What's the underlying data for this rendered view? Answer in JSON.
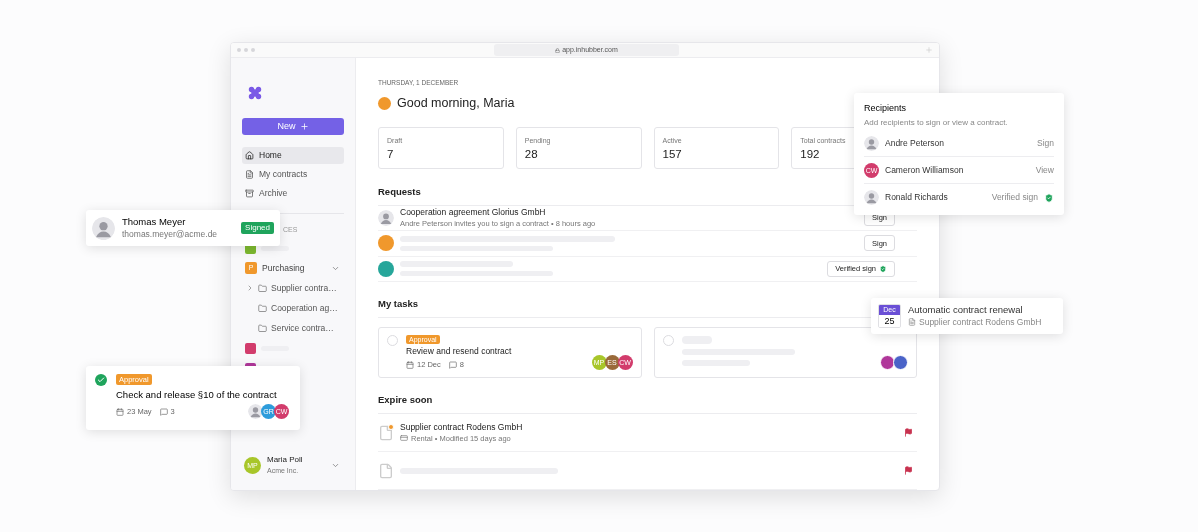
{
  "window": {
    "url": "app.inhubber.com"
  },
  "sidebar": {
    "new_button": "New",
    "nav": [
      {
        "label": "Home",
        "selected": true
      },
      {
        "label": "My contracts",
        "selected": false
      },
      {
        "label": "Archive",
        "selected": false
      }
    ],
    "section_label": "CES",
    "workspaces": [
      {
        "kind": "placeholder",
        "color": "#7cb82f"
      },
      {
        "kind": "workspace",
        "letter": "P",
        "label": "Purchasing",
        "color": "#f0982c",
        "expanded": true,
        "children": [
          {
            "label": "Supplier contra…",
            "has_children": true
          },
          {
            "label": "Cooperation ag…",
            "has_children": false
          },
          {
            "label": "Service contra…",
            "has_children": false
          }
        ]
      },
      {
        "kind": "placeholder",
        "color": "#d23c6c"
      },
      {
        "kind": "placeholder",
        "color": "#b0379a"
      }
    ],
    "user": {
      "initials": "MP",
      "name": "Maria Poll",
      "org": "Acme Inc.",
      "color": "#a8c62a"
    }
  },
  "main": {
    "date": "THURSDAY, 1 DECEMBER",
    "greeting": "Good morning, Maria",
    "stats": [
      {
        "label": "Draft",
        "value": "7"
      },
      {
        "label": "Pending",
        "value": "28"
      },
      {
        "label": "Active",
        "value": "157"
      },
      {
        "label": "Total contracts",
        "value": "192"
      }
    ],
    "requests": {
      "title": "Requests",
      "rows": [
        {
          "kind": "request",
          "title": "Cooperation agreement Glorius GmbH",
          "subtitle": "Andre Peterson invites you to sign a contract • 8 hours ago",
          "action": "Sign",
          "verified": false
        },
        {
          "kind": "placeholder",
          "color": "#f0982c",
          "action": "Sign",
          "verified": false
        },
        {
          "kind": "placeholder",
          "color": "#26a69a",
          "action": "Verified sign",
          "verified": true
        }
      ]
    },
    "tasks": {
      "title": "My tasks",
      "items": [
        {
          "kind": "task",
          "tag": "Approval",
          "title": "Review and resend contract",
          "date": "12 Dec",
          "comments": "8",
          "done": false,
          "assignees": [
            {
              "kind": "initials",
              "initials": "MP",
              "color": "#a8c62a"
            },
            {
              "kind": "initials",
              "initials": "ES",
              "color": "#9a6a3a"
            },
            {
              "kind": "initials",
              "initials": "CW",
              "color": "#d23c6c"
            }
          ]
        },
        {
          "kind": "placeholder",
          "done": false,
          "assignees": [
            {
              "kind": "blank",
              "color": "#b0379a"
            },
            {
              "kind": "blank",
              "color": "#4a63c8"
            }
          ]
        }
      ]
    },
    "expire": {
      "title": "Expire soon",
      "rows": [
        {
          "kind": "contract",
          "title": "Supplier contract Rodens GmbH",
          "meta": "Rental • Modified 15 days ago"
        },
        {
          "kind": "placeholder"
        }
      ]
    }
  },
  "overlays": {
    "contact": {
      "name": "Thomas Meyer",
      "email": "thomas.meyer@acme.de",
      "status": "Signed"
    },
    "approval": {
      "done": true,
      "tag": "Approval",
      "title": "Check and release §10 of the contract",
      "date": "23 May",
      "comments": "3",
      "assignees": [
        {
          "kind": "photo"
        },
        {
          "kind": "initials",
          "initials": "GR",
          "color": "#2d9cdb"
        },
        {
          "kind": "initials",
          "initials": "CW",
          "color": "#d23c6c"
        }
      ]
    },
    "recipients": {
      "title": "Recipients",
      "subtitle": "Add recipients to sign or view a contract.",
      "rows": [
        {
          "name": "Andre Peterson",
          "avatar": {
            "kind": "photo"
          },
          "role": "Sign",
          "verified": false
        },
        {
          "name": "Cameron Williamson",
          "avatar": {
            "kind": "initials",
            "initials": "CW",
            "color": "#d23c6c"
          },
          "role": "View",
          "verified": false
        },
        {
          "name": "Ronald Richards",
          "avatar": {
            "kind": "photo"
          },
          "role": "Verified sign",
          "verified": true
        }
      ]
    },
    "renewal": {
      "month": "Dec",
      "day": "25",
      "title": "Automatic contract renewal",
      "contract": "Supplier contract Rodens GmbH"
    }
  }
}
